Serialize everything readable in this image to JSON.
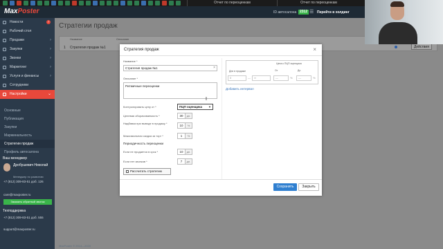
{
  "topbar": {
    "tabs": [
      "Отчет по переоценкам",
      "Отчет по переоценкам"
    ],
    "window_controls": [
      "—",
      "☐",
      "✕"
    ]
  },
  "header": {
    "logo_prefix": "Max",
    "logo_suffix": "Poster",
    "dealer_label": "ID автосалона",
    "dealer_id": "2312",
    "goto_label": "Перейти в холдинг",
    "accent_color": "#e9483b"
  },
  "sidebar": {
    "items": [
      {
        "label": "Новости",
        "badge": "7"
      },
      {
        "label": "Рабочий стол"
      },
      {
        "label": "Продажи"
      },
      {
        "label": "Закупки"
      },
      {
        "label": "Звонки"
      },
      {
        "label": "Маркетинг"
      },
      {
        "label": "Услуги и финансы"
      },
      {
        "label": "Сотрудники"
      },
      {
        "label": "Настройки"
      }
    ],
    "sub_items": [
      "Основные",
      "Публикация",
      "Закупки",
      "Маржинальность",
      "Стратегии продаж",
      "Профиль автосалона"
    ],
    "manager": {
      "title": "Ваш менеджер",
      "name": "Дробушевич Николай",
      "role": "Менеджер по развитию",
      "phone": "+7 (812) 309-83-51 доб. 126",
      "email": "care@maxposter.ru",
      "callback_button": "Заказать обратный звонок"
    },
    "support": {
      "title": "Техподдержка",
      "phone": "+7 (812) 309-83-51 доб. 555",
      "email": "support@maxposter.ru"
    }
  },
  "page": {
    "title": "Стратегии продаж",
    "table_headers": [
      "Название",
      "Описание",
      "По умолчанию"
    ],
    "row": {
      "num": "1",
      "name": "Стратегия продаж №1",
      "actions": "Действия"
    },
    "footer_text": "MaxPoster © 2014—2020"
  },
  "modal": {
    "title": "Стратегия продаж",
    "name_label": "Название *",
    "name_value": "Стратегия продаж №1",
    "desc_label": "Описание *",
    "desc_value": "Ритмичные переоценки",
    "control_label": "Контролировать цену от *",
    "control_value": "ПЦП оценщика",
    "target_turnover_label": "Целевая оборачиваемость *",
    "target_turnover_value": "30",
    "target_turnover_unit": "дн.",
    "markup_label": "Надбавка при выводе в продажу *",
    "markup_value": "10",
    "markup_unit": "%",
    "max_discount_label": "Максимальная скидка за торг *",
    "max_discount_value": "1",
    "max_discount_unit": "%",
    "period_section": "Периодичность переоценки",
    "not_sold_label": "Если не продается в срок *",
    "not_sold_value": "10",
    "not_sold_unit": "дн.",
    "no_calls_label": "Если нет звонков *",
    "no_calls_value": "7",
    "no_calls_unit": "дн.",
    "calc_button": "Рассчитать стратегию",
    "grid": {
      "days_header": "Дни в продаже",
      "price_header": "Цена к ПЦП оценщика",
      "from_header": "От",
      "to_header": "До",
      "days_from": "0",
      "days_to": "∞",
      "price_from": "—",
      "price_to": "—",
      "pct": "%"
    },
    "add_interval": "Добавить интервал",
    "save_button": "Сохранить",
    "close_button": "Закрыть"
  }
}
